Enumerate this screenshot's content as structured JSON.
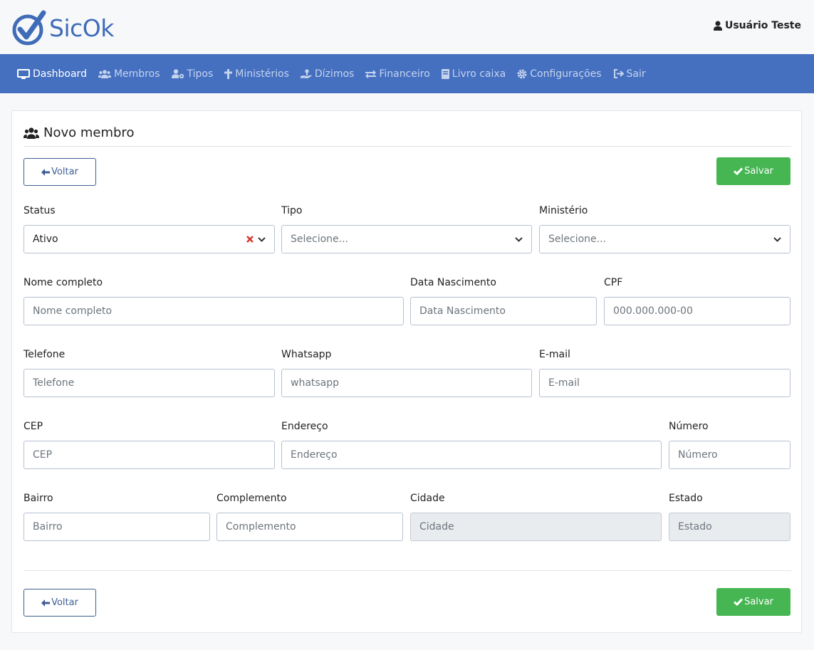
{
  "brand": {
    "name": "SicOk",
    "color": "#3f6cb8"
  },
  "user": {
    "name": "Usuário Teste"
  },
  "nav": [
    {
      "label": "Dashboard",
      "icon": "monitor-icon",
      "active": true
    },
    {
      "label": "Membros",
      "icon": "users-icon",
      "active": false
    },
    {
      "label": "Tipos",
      "icon": "user-cog-icon",
      "active": false
    },
    {
      "label": "Ministérios",
      "icon": "cross-icon",
      "active": false
    },
    {
      "label": "Dízimos",
      "icon": "hand-donate-icon",
      "active": false
    },
    {
      "label": "Financeiro",
      "icon": "exchange-icon",
      "active": false
    },
    {
      "label": "Livro caixa",
      "icon": "book-icon",
      "active": false
    },
    {
      "label": "Configurações",
      "icon": "gear-icon",
      "active": false
    },
    {
      "label": "Sair",
      "icon": "sign-out-icon",
      "active": false
    }
  ],
  "page": {
    "title": "Novo membro",
    "back_label": "Voltar",
    "save_label": "Salvar"
  },
  "form": {
    "status": {
      "label": "Status",
      "value": "Ativo"
    },
    "tipo": {
      "label": "Tipo",
      "placeholder": "Selecione..."
    },
    "ministerio": {
      "label": "Ministério",
      "placeholder": "Selecione..."
    },
    "nome": {
      "label": "Nome completo",
      "placeholder": "Nome completo"
    },
    "nascimento": {
      "label": "Data Nascimento",
      "placeholder": "Data Nascimento"
    },
    "cpf": {
      "label": "CPF",
      "placeholder": "000.000.000-00"
    },
    "telefone": {
      "label": "Telefone",
      "placeholder": "Telefone"
    },
    "whatsapp": {
      "label": "Whatsapp",
      "placeholder": "whatsapp"
    },
    "email": {
      "label": "E-mail",
      "placeholder": "E-mail"
    },
    "cep": {
      "label": "CEP",
      "placeholder": "CEP"
    },
    "endereco": {
      "label": "Endereço",
      "placeholder": "Endereço"
    },
    "numero": {
      "label": "Número",
      "placeholder": "Número"
    },
    "bairro": {
      "label": "Bairro",
      "placeholder": "Bairro"
    },
    "complemento": {
      "label": "Complemento",
      "placeholder": "Complemento"
    },
    "cidade": {
      "label": "Cidade",
      "placeholder": "Cidade"
    },
    "estado": {
      "label": "Estado",
      "placeholder": "Estado"
    }
  },
  "colors": {
    "navbar": "#4570c0",
    "save": "#46b653",
    "back_border": "#3f5f94",
    "clear_x": "#d9342b"
  }
}
